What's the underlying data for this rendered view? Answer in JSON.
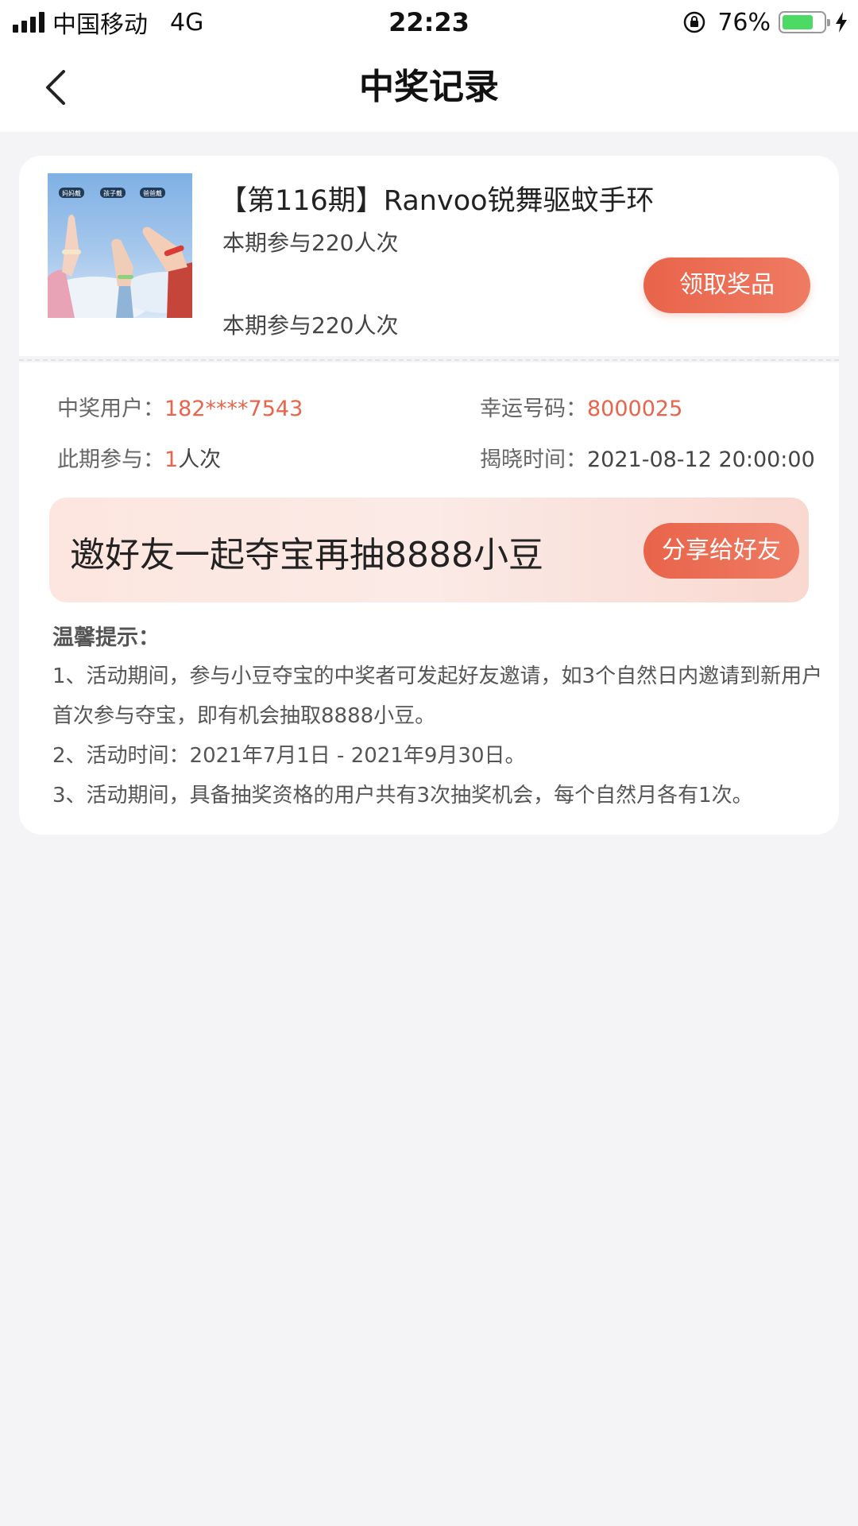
{
  "status_bar": {
    "carrier": "中国移动",
    "network": "4G",
    "time": "22:23",
    "battery_percent": "76%",
    "battery_level": 0.76,
    "battery_color": "#4cd964"
  },
  "nav": {
    "title": "中奖记录",
    "back_icon": "chevron-left-icon"
  },
  "product": {
    "title": "【第116期】Ranvoo锐舞驱蚊手环",
    "participants_1": "本期参与220人次",
    "participants_2": "本期参与220人次",
    "claim_label": "领取奖品",
    "image_tags": [
      "妈妈戴",
      "孩子戴",
      "爸爸戴"
    ]
  },
  "details": {
    "winner_label": "中奖用户：",
    "winner_value": "182****7543",
    "lucky_label": "幸运号码：",
    "lucky_value": "8000025",
    "join_label": "此期参与：",
    "join_count": "1",
    "join_unit": "人次",
    "reveal_label": "揭晓时间：",
    "reveal_value": "2021-08-12 20:00:00"
  },
  "invite": {
    "text": "邀好友一起夺宝再抽8888小豆",
    "share_label": "分享给好友"
  },
  "tips": {
    "title": "温馨提示：",
    "items": [
      "1、活动期间，参与小豆夺宝的中奖者可发起好友邀请，如3个自然日内邀请到新用户首次参与夺宝，即有机会抽取8888小豆。",
      "2、活动时间：2021年7月1日 - 2021年9月30日。",
      "3、活动期间，具备抽奖资格的用户共有3次抽奖机会，每个自然月各有1次。"
    ]
  },
  "colors": {
    "accent": "#e8644a",
    "background": "#f4f4f6"
  }
}
